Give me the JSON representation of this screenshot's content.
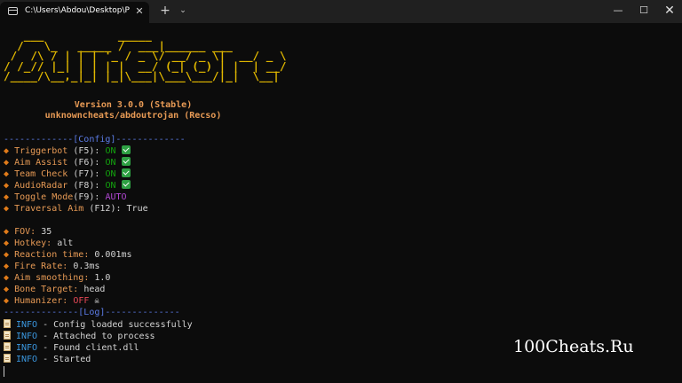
{
  "window": {
    "tab_title": "C:\\Users\\Abdou\\Desktop\\P-N",
    "tab_close": "✕",
    "new_tab": "+",
    "dropdown": "⌄",
    "minimize": "—",
    "maximize": "☐",
    "close": "✕"
  },
  "banner": {
    "art": "   ___           _____\n  /   \\_   _____ /  ___|______ ___\n /  /\\ / | | | '_ / _ \\/ __/ _ \\|  __/ _ \\\n/ /_// |_| | | | |  __/ (_| (_) | |  | __/\n/____/\\__,_|_| |_|\\___|\\___\\___/|_|  \\__|",
    "version": "Version 3.0.0 (Stable)",
    "author": "unknowncheats/abdoutrojan (Recso)"
  },
  "config": {
    "divider": "-------------[Config]-------------",
    "bullet": "◆",
    "items": [
      {
        "label": "Triggerbot",
        "key": "(F5):",
        "value": "ON"
      },
      {
        "label": "Aim Assist",
        "key": "(F6):",
        "value": "ON"
      },
      {
        "label": "Team Check",
        "key": "(F7):",
        "value": "ON"
      },
      {
        "label": "AudioRadar",
        "key": "(F8):",
        "value": "ON"
      },
      {
        "label": "Toggle Mode",
        "key": "(F9):",
        "value": "AUTO"
      },
      {
        "label": "Traversal Aim",
        "key": "(F12):",
        "value": "True"
      }
    ],
    "settings": [
      {
        "label": "FOV:",
        "value": "35"
      },
      {
        "label": "Hotkey:",
        "value": "alt"
      },
      {
        "label": "Reaction time:",
        "value": "0.001ms"
      },
      {
        "label": "Fire Rate:",
        "value": "0.3ms"
      },
      {
        "label": "Aim smoothing:",
        "value": "1.0"
      },
      {
        "label": "Bone Target:",
        "value": "head"
      },
      {
        "label": "Humanizer:",
        "value": "OFF"
      }
    ],
    "skull": "☠"
  },
  "log": {
    "divider": "--------------[Log]--------------",
    "entries": [
      {
        "level": "INFO",
        "message": "- Config loaded successfully"
      },
      {
        "level": "INFO",
        "message": "- Attached to process"
      },
      {
        "level": "INFO",
        "message": "- Found client.dll"
      },
      {
        "level": "INFO",
        "message": "- Started"
      }
    ]
  },
  "watermark": "100Cheats.Ru",
  "colors": {
    "banner": "#e0b700",
    "divider": "#5b7be6",
    "key": "#e79a55",
    "on": "#13a10e",
    "auto": "#b248d4",
    "off": "#e74856",
    "info": "#3a96dd"
  }
}
